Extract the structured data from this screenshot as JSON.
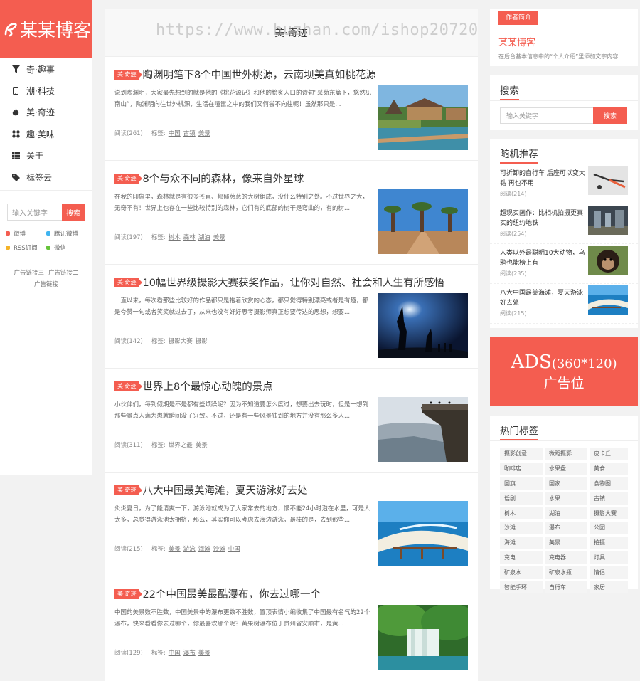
{
  "logo": {
    "text": "某某博客"
  },
  "nav": [
    {
      "label": "奇·趣事",
      "icon": "filter-icon"
    },
    {
      "label": "潮·科技",
      "icon": "mobile-icon"
    },
    {
      "label": "美·奇迹",
      "icon": "fire-icon"
    },
    {
      "label": "趣·美味",
      "icon": "grid-icon"
    },
    {
      "label": "关于",
      "icon": "list-icon"
    },
    {
      "label": "标签云",
      "icon": "tag-icon"
    }
  ],
  "side_search": {
    "placeholder": "输入关键字",
    "button": "搜索"
  },
  "social": [
    {
      "label": "微博",
      "color": "#f45d50"
    },
    {
      "label": "腾讯微博",
      "color": "#3fb4f0"
    },
    {
      "label": "RSS订阅",
      "color": "#f4b328"
    },
    {
      "label": "微信",
      "color": "#66c33a"
    }
  ],
  "left_links": {
    "l1": "广告链接三",
    "l2": "广告链接二",
    "l3": "广告链接"
  },
  "main": {
    "heading": "美·奇迹",
    "watermark": "https://www.huzhan.com/ishop20720",
    "articles": [
      {
        "badge": "美·奇迹",
        "title": "陶渊明笔下8个中国世外桃源，云南坝美真如桃花源",
        "excerpt": "说到陶渊明，大家最先想到的就是他的《桃花源记》和他的脍炙人口的诗句“采菊东篱下，悠然见南山”，陶渊明向往世外桃源，生活在喧嚣之中的我们又何尝不向往呢！虽然那只是...",
        "reads": "阅读(261)",
        "tags_label": "标签:",
        "tags": [
          "中国",
          "古镇",
          "美景"
        ]
      },
      {
        "badge": "美·奇迹",
        "title": "8个与众不同的森林，像来自外星球",
        "excerpt": "在我的印象里，森林就是有很多苍直、郁郁葱葱的大树组成，没什么特别之处。不过世界之大，无奇不有！世界上也存在一些比较特别的森林，它们有的底部的树干是弯曲的，有的树...",
        "reads": "阅读(197)",
        "tags_label": "标签:",
        "tags": [
          "树木",
          "森林",
          "湖泊",
          "美景"
        ]
      },
      {
        "badge": "美·奇迹",
        "title": "10幅世界级摄影大赛获奖作品，让你对自然、社会和人生有所感悟",
        "excerpt": "一直以来，每次看那些比较好的作品都只是抱着欣赏的心态，都只觉得特别漂亮或者是有趣，都是夸赞一句或者笑笑就过去了，从来也没有好好思考摄影师真正想要传达的思想，想要...",
        "reads": "阅读(142)",
        "tags_label": "标签:",
        "tags": [
          "摄影大赛",
          "摄影"
        ]
      },
      {
        "badge": "美·奇迹",
        "title": "世界上8个最惊心动魄的景点",
        "excerpt": "小伙伴们，每到假期是不是都有些烦躁呢？因为不知道要怎么度过，想要出去玩时，但是一想到那些景点人满为患就瞬间没了兴致。不过，还是有一些风景独到的地方并没有那么多人...",
        "reads": "阅读(311)",
        "tags_label": "标签:",
        "tags": [
          "世界之最",
          "美景"
        ]
      },
      {
        "badge": "美·奇迹",
        "title": "八大中国最美海滩，夏天游泳好去处",
        "excerpt": "炎炎夏日，为了能清爽一下，游泳池就成为了大家常去的地方，恨不能24小时泡在水里，可是人太多，总觉得游泳池太拥挤，那么，其实你可以考虑去海边游泳，最棒的是，去到那些...",
        "reads": "阅读(215)",
        "tags_label": "标签:",
        "tags": [
          "美景",
          "游泳",
          "海滩",
          "沙滩",
          "中国"
        ]
      },
      {
        "badge": "美·奇迹",
        "title": "22个中国最美最酷瀑布，你去过哪一个",
        "excerpt": "中国的美景数不胜数，中国美景中的瀑布更数不胜数，置顶表情小编收集了中国最有名气的22个瀑布，快来看看你去过哪个，你最喜欢哪个呢？黄果树瀑布位于贵州省安顺市，是黄...",
        "reads": "阅读(129)",
        "tags_label": "标签:",
        "tags": [
          "中国",
          "瀑布",
          "美景"
        ]
      }
    ]
  },
  "author": {
    "tab": "作者简介",
    "name": "某某博客",
    "desc": "在后台基本信息中的“个人介绍”里添加文字内容"
  },
  "right_search": {
    "title": "搜索",
    "placeholder": "输入关键字",
    "button": "搜索"
  },
  "recommend": {
    "title": "随机推荐",
    "items": [
      {
        "title": "可折卸的自行车 后座可以变大钻 再也不用",
        "reads": "阅读(214)"
      },
      {
        "title": "超现实画作：比相机拍摄更真实的纽约地铁",
        "reads": "阅读(254)"
      },
      {
        "title": "人类以外最聪明10大动物，乌鸦也能榜上有",
        "reads": "阅读(235)"
      },
      {
        "title": "八大中国最美海滩，夏天游泳好去处",
        "reads": "阅读(215)"
      }
    ]
  },
  "ads": {
    "line1": "ADS",
    "line1_size": "(360*120)",
    "line2": "广告位"
  },
  "hot_tags": {
    "title": "热门标签",
    "tags": [
      "摄影创意",
      "微距摄影",
      "皮卡丘",
      "咖啡店",
      "水果盘",
      "美食",
      "国旗",
      "国家",
      "食物图",
      "话剧",
      "水果",
      "古镇",
      "树木",
      "湖泊",
      "摄影大赛",
      "沙滩",
      "瀑布",
      "公园",
      "海滩",
      "美景",
      "拍摄",
      "充电",
      "充电器",
      "灯具",
      "矿泉水",
      "矿泉水瓶",
      "情侣",
      "智能手环",
      "自行车",
      "家居"
    ]
  }
}
